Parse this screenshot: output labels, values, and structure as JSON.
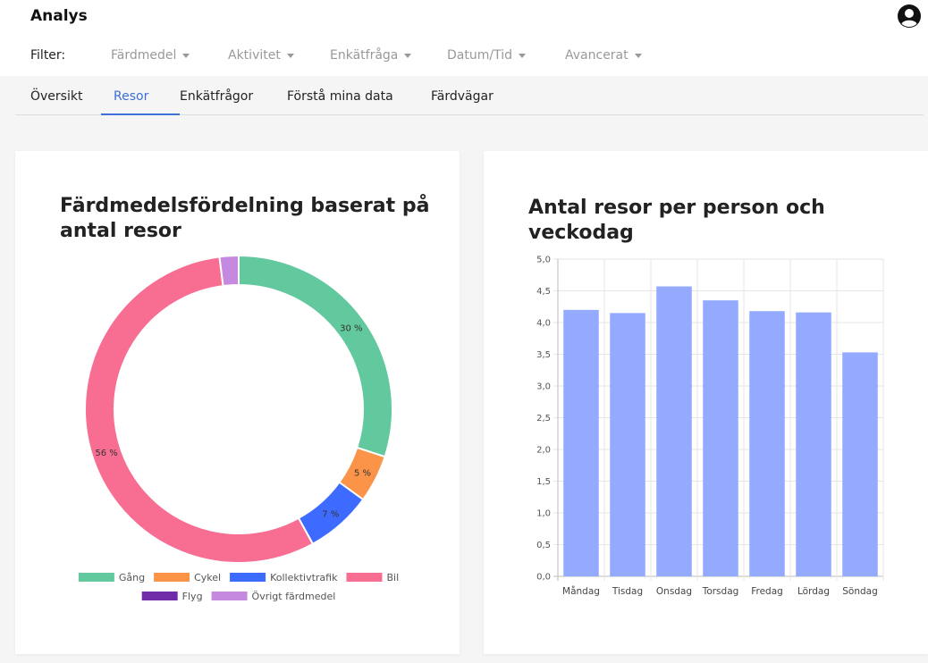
{
  "app": {
    "title": "Analys"
  },
  "filters": {
    "label": "Filter:",
    "items": [
      {
        "label": "Färdmedel"
      },
      {
        "label": "Aktivitet"
      },
      {
        "label": "Enkätfråga"
      },
      {
        "label": "Datum/Tid"
      },
      {
        "label": "Avancerat"
      }
    ]
  },
  "tabs": [
    {
      "label": "Översikt"
    },
    {
      "label": "Resor",
      "active": true
    },
    {
      "label": "Enkätfrågor"
    },
    {
      "label": "Förstå mina data"
    },
    {
      "label": "Färdvägar"
    }
  ],
  "colors": {
    "accent": "#3d6fd8"
  },
  "icons": {
    "user": "user-circle-icon",
    "dropdown": "caret-down-icon"
  },
  "chart_data": [
    {
      "type": "pie",
      "title_line1": "Färdmedelsfördelning baserat på",
      "title_line2": "antal resor",
      "slices": [
        {
          "name": "Gång",
          "value": 30,
          "label": "30 %",
          "color": "#62c89e"
        },
        {
          "name": "Cykel",
          "value": 5,
          "label": "5 %",
          "color": "#fb9448"
        },
        {
          "name": "Kollektivtrafik",
          "value": 7,
          "label": "7 %",
          "color": "#3e6bff"
        },
        {
          "name": "Bil",
          "value": 56,
          "label": "56 %",
          "color": "#f86e93"
        },
        {
          "name": "Flyg",
          "value": 0,
          "label": "",
          "color": "#6f2ba8"
        },
        {
          "name": "Övrigt färdmedel",
          "value": 2,
          "label": "",
          "color": "#c58ae0"
        }
      ],
      "legend": "bottom"
    },
    {
      "type": "bar",
      "title_line1": "Antal resor per person och",
      "title_line2": "veckodag",
      "categories": [
        "Måndag",
        "Tisdag",
        "Onsdag",
        "Torsdag",
        "Fredag",
        "Lördag",
        "Söndag"
      ],
      "values": [
        4.2,
        4.15,
        4.57,
        4.35,
        4.18,
        4.16,
        3.53
      ],
      "ylim": [
        0,
        5
      ],
      "yticks": [
        "0,0",
        "0,5",
        "1,0",
        "1,5",
        "2,0",
        "2,5",
        "3,0",
        "3,5",
        "4,0",
        "4,5",
        "5,0"
      ],
      "grid": true,
      "bar_color": "#93aafe"
    }
  ]
}
